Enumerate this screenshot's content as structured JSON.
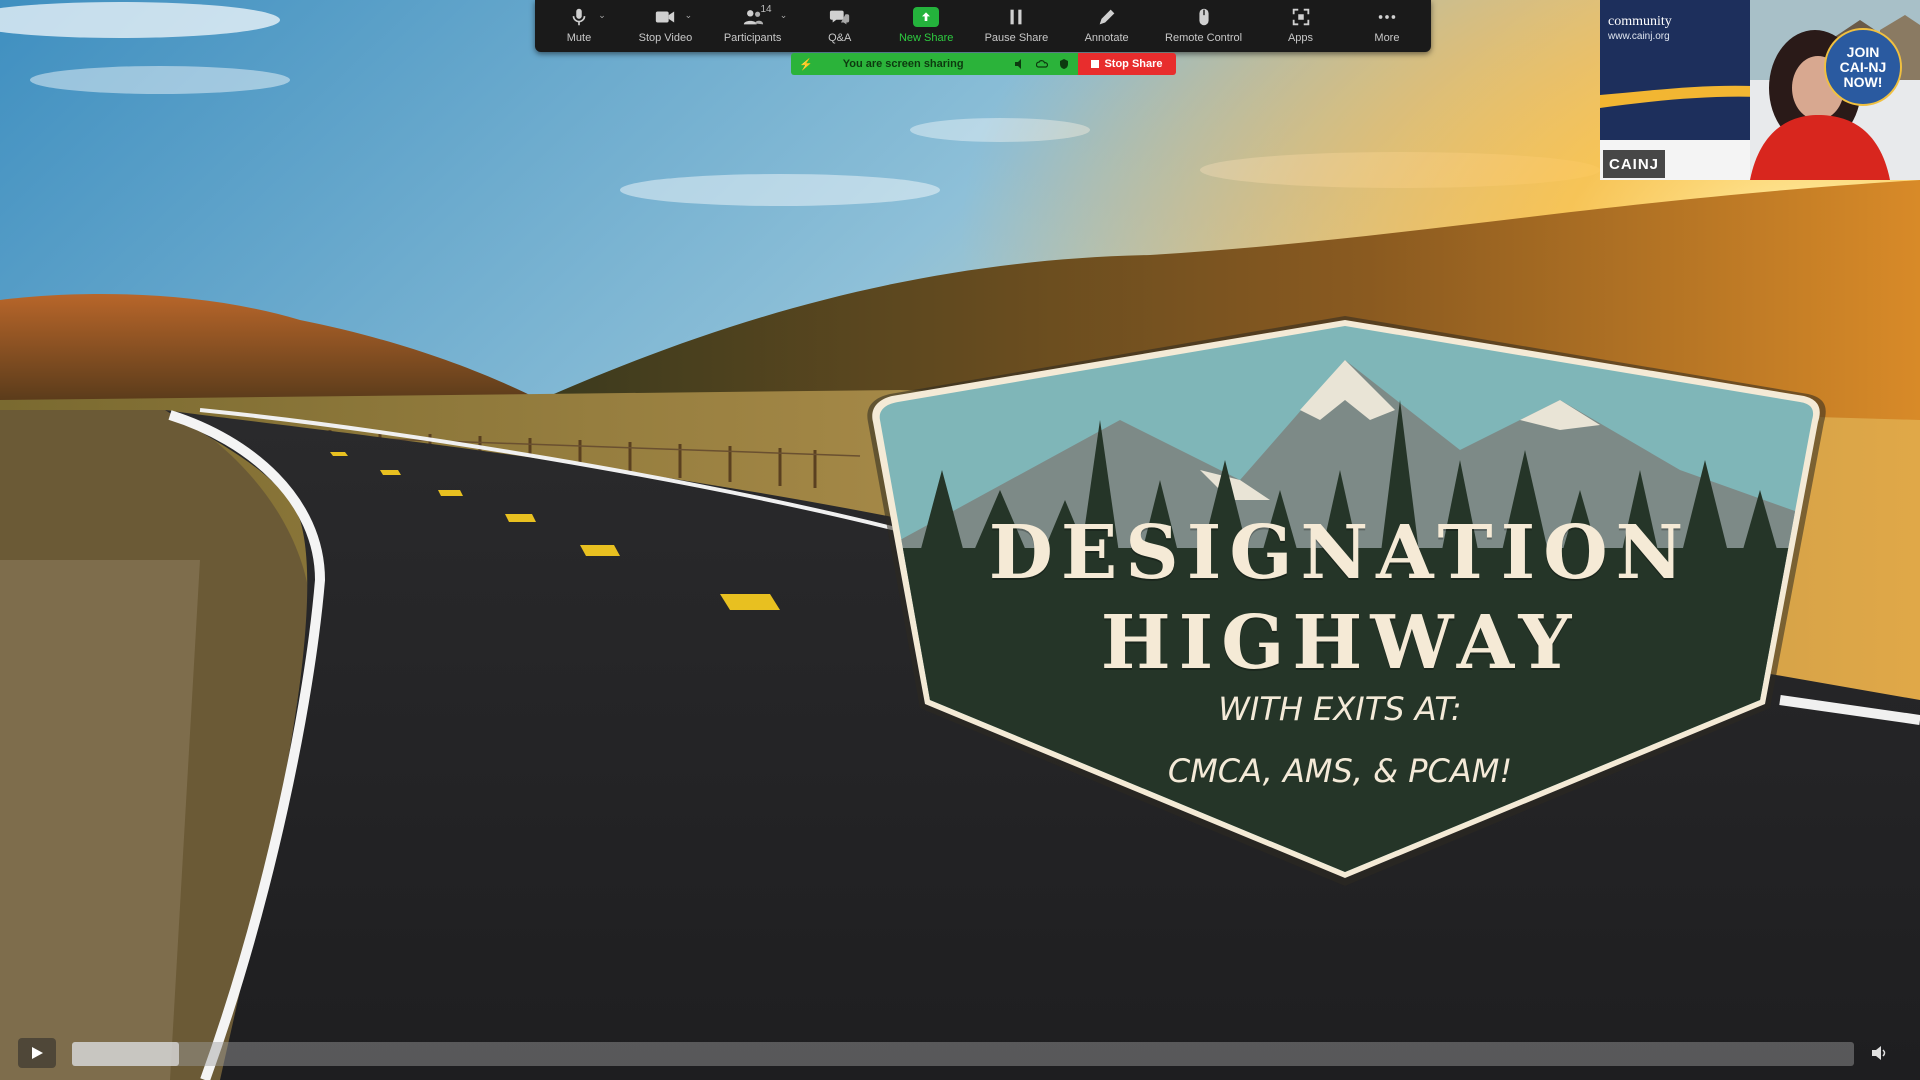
{
  "zoom_toolbar": {
    "items": [
      {
        "label": "Mute",
        "icon": "microphone-icon",
        "has_caret": true
      },
      {
        "label": "Stop Video",
        "icon": "video-camera-icon",
        "has_caret": true
      },
      {
        "label": "Participants",
        "icon": "participants-icon",
        "count": "14",
        "has_caret": true
      },
      {
        "label": "Q&A",
        "icon": "qa-bubbles-icon"
      },
      {
        "label": "New Share",
        "icon": "share-arrow-icon",
        "accent": "#24b33c"
      },
      {
        "label": "Pause Share",
        "icon": "pause-icon"
      },
      {
        "label": "Annotate",
        "icon": "pencil-icon"
      },
      {
        "label": "Remote Control",
        "icon": "mouse-icon"
      },
      {
        "label": "Apps",
        "icon": "apps-icon"
      },
      {
        "label": "More",
        "icon": "more-dots-icon"
      }
    ]
  },
  "share_banner": {
    "status_text": "You are screen sharing",
    "stop_label": "Stop Share",
    "status_color": "#2bb33a",
    "stop_color": "#e82d2d"
  },
  "webcam": {
    "name": "CAINJ",
    "logo_text": "community",
    "logo_url_text": "www.cainj.org",
    "badge_line1": "JOIN",
    "badge_line2": "CAI-NJ",
    "badge_line3": "NOW!"
  },
  "slide": {
    "title_line1": "DESIGNATION",
    "title_line2": "HIGHWAY",
    "subtitle_line1": "WITH EXITS AT:",
    "subtitle_line2": "CMCA, AMS, & PCAM!"
  },
  "player": {
    "progress_fraction": 0.06
  }
}
